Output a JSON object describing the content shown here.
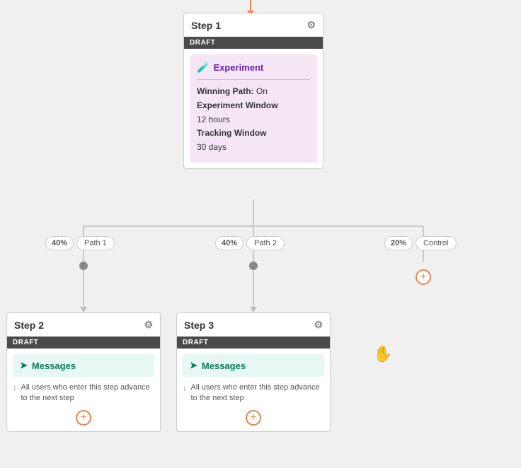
{
  "topArrow": {
    "color": "#e8834a"
  },
  "step1": {
    "title": "Step 1",
    "badge": "DRAFT",
    "experiment": {
      "label": "Experiment",
      "winningPath": "Winning Path:",
      "winningPathValue": "On",
      "experimentWindow": "Experiment Window",
      "experimentWindowValue": "12 hours",
      "trackingWindow": "Tracking Window",
      "trackingWindowValue": "30 days"
    }
  },
  "paths": [
    {
      "pct": "40%",
      "label": "Path 1"
    },
    {
      "pct": "40%",
      "label": "Path 2"
    },
    {
      "pct": "20%",
      "label": "Control"
    }
  ],
  "step2": {
    "title": "Step 2",
    "badge": "DRAFT",
    "messages": "Messages",
    "advance": "All users who enter this step advance to the next step"
  },
  "step3": {
    "title": "Step 3",
    "badge": "DRAFT",
    "messages": "Messages",
    "advance": "All users who enter this step advance to the next step"
  },
  "icons": {
    "gear": "⚙",
    "flask": "🧪",
    "message": "➤",
    "advance": "↓",
    "plus": "+",
    "cursor": "☝"
  }
}
